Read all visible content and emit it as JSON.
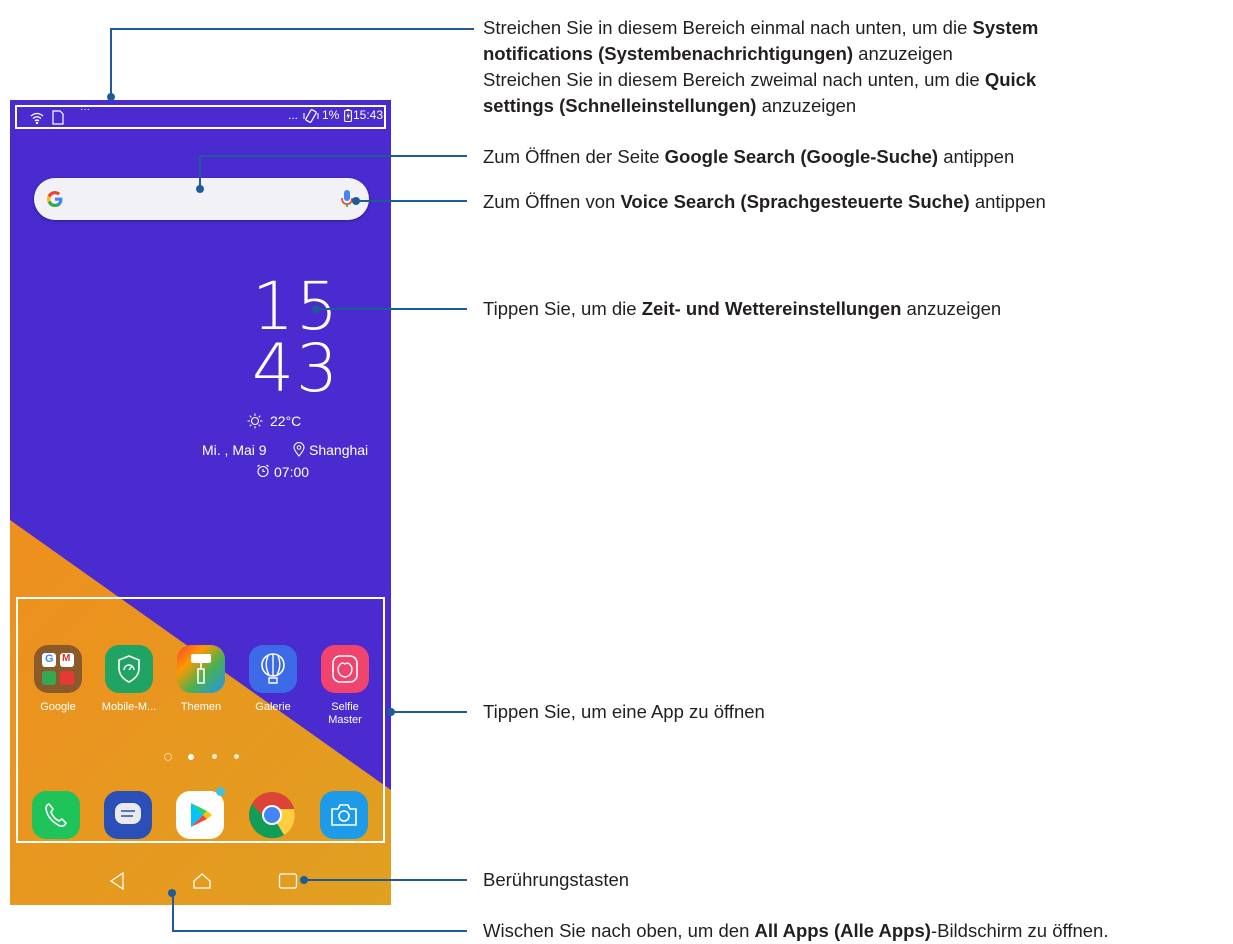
{
  "status_bar": {
    "left_extra": "···",
    "right_extra": "...",
    "battery": "1%",
    "time": "15:43"
  },
  "clock": {
    "hour": "15",
    "minute": "43",
    "temperature": "22°C",
    "date": "Mi. , Mai 9",
    "city": "Shanghai",
    "alarm": "07:00"
  },
  "apps": [
    {
      "label": "Google",
      "icon": "google-folder-icon"
    },
    {
      "label": "Mobile-M...",
      "icon": "mobile-manager-icon"
    },
    {
      "label": "Themen",
      "icon": "themes-icon"
    },
    {
      "label": "Galerie",
      "icon": "gallery-icon"
    },
    {
      "label": "Selfie\nMaster",
      "icon": "selfie-master-icon"
    }
  ],
  "dock": [
    {
      "icon": "phone-icon"
    },
    {
      "icon": "messages-icon"
    },
    {
      "icon": "play-store-icon"
    },
    {
      "icon": "chrome-icon"
    },
    {
      "icon": "camera-icon"
    }
  ],
  "colors": {
    "wallpaper_blue": "#4a2bcf",
    "wallpaper_orange": "#e8891b",
    "callout_line": "#1f5b96"
  },
  "annotations": {
    "status_line1_pre": "Streichen Sie in diesem Bereich einmal nach unten, um die ",
    "status_line1_bold": "System",
    "status_line2_bold": "notifications (Systembenachrichtigungen)",
    "status_line2_post": " anzuzeigen",
    "status_line3": "Streichen Sie in diesem Bereich zweimal nach unten, um die ",
    "status_line3_bold": "Quick",
    "status_line4_bold": "settings (Schnelleinstellungen)",
    "status_line4_post": " anzuzeigen",
    "search_pre": "Zum Öffnen der Seite ",
    "search_bold": "Google Search (Google-Suche)",
    "search_post": " antippen",
    "voice_pre": "Zum Öffnen von ",
    "voice_bold": "Voice Search (Sprachgesteuerte Suche)",
    "voice_post": " antippen",
    "clock_pre": "Tippen Sie, um die ",
    "clock_bold": "Zeit- und Wettereinstellungen",
    "clock_post": " anzuzeigen",
    "apps_text": "Tippen Sie, um eine App zu öffnen",
    "nav_text": "Berührungstasten",
    "allapps_pre": "Wischen Sie nach oben, um den ",
    "allapps_bold": "All Apps (Alle Apps)",
    "allapps_post": "-Bildschirm zu öffnen."
  }
}
